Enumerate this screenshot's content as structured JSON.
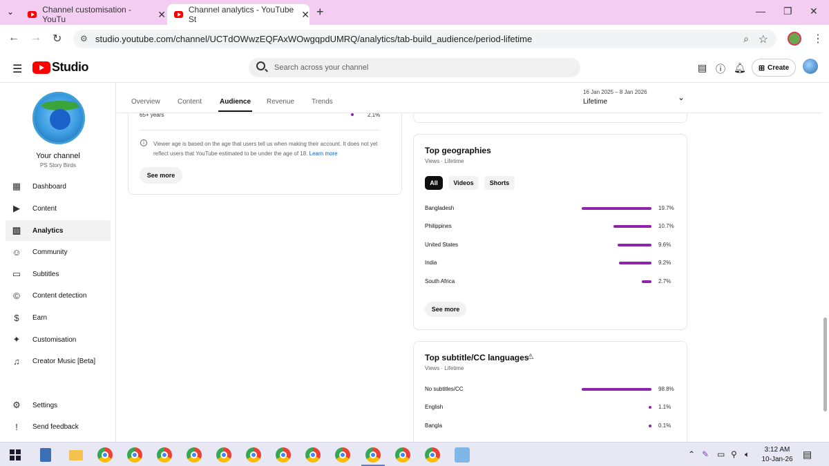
{
  "browser": {
    "tabs": [
      {
        "title": "Channel customisation - YouTu"
      },
      {
        "title": "Channel analytics - YouTube St"
      }
    ],
    "new_tab": "+",
    "url": "studio.youtube.com/channel/UCTdOWwzEQFAxWOwgqpdUMRQ/analytics/tab-build_audience/period-lifetime"
  },
  "header": {
    "logo_text": "Studio",
    "search_placeholder": "Search across your channel",
    "create_label": "Create"
  },
  "sidebar": {
    "your_channel": "Your channel",
    "channel_name": "PS Story Birds",
    "items": [
      {
        "label": "Dashboard",
        "icon": "dashboard-icon"
      },
      {
        "label": "Content",
        "icon": "content-icon"
      },
      {
        "label": "Analytics",
        "icon": "analytics-icon",
        "active": true
      },
      {
        "label": "Community",
        "icon": "community-icon"
      },
      {
        "label": "Subtitles",
        "icon": "subtitles-icon"
      },
      {
        "label": "Content detection",
        "icon": "copyright-icon"
      },
      {
        "label": "Earn",
        "icon": "dollar-icon"
      },
      {
        "label": "Customisation",
        "icon": "magic-wand-icon"
      },
      {
        "label": "Creator Music [Beta]",
        "icon": "music-icon"
      },
      {
        "label": "Settings",
        "icon": "gear-icon"
      },
      {
        "label": "Send feedback",
        "icon": "feedback-icon"
      }
    ]
  },
  "tabs": {
    "items": [
      "Overview",
      "Content",
      "Audience",
      "Revenue",
      "Trends"
    ],
    "active": "Audience"
  },
  "date": {
    "range": "16 Jan 2025 – 8 Jan 2026",
    "period": "Lifetime"
  },
  "age_card": {
    "last_row_label": "65+ years",
    "last_row_pct": "2.1%",
    "info_text": "Viewer age is based on the age that users tell us when making their account. It does not yet reflect users that YouTube estimated to be under the age of 18.",
    "learn_more": "Learn more",
    "see_more": "See more"
  },
  "geo_card": {
    "title": "Top geographies",
    "subtitle": "Views · Lifetime",
    "chips": [
      "All",
      "Videos",
      "Shorts"
    ],
    "rows": [
      {
        "label": "Bangladesh",
        "pct": "19.7%",
        "value": 19.7
      },
      {
        "label": "Philippines",
        "pct": "10.7%",
        "value": 10.7
      },
      {
        "label": "United States",
        "pct": "9.6%",
        "value": 9.6
      },
      {
        "label": "India",
        "pct": "9.2%",
        "value": 9.2
      },
      {
        "label": "South Africa",
        "pct": "2.7%",
        "value": 2.7
      }
    ],
    "see_more": "See more"
  },
  "subtitle_card": {
    "title": "Top subtitle/CC languages",
    "subtitle": "Views · Lifetime",
    "rows": [
      {
        "label": "No subtitles/CC",
        "pct": "98.8%",
        "value": 98.8
      },
      {
        "label": "English",
        "pct": "1.1%",
        "value": 1.1
      },
      {
        "label": "Bangla",
        "pct": "0.1%",
        "value": 0.1
      }
    ]
  },
  "taskbar": {
    "time": "3:12 AM",
    "date": "10-Jan-26"
  },
  "colors": {
    "accent_bar": "#8e24aa",
    "tab_strip": "#f4cdf3",
    "yt_red": "#ff0000"
  }
}
